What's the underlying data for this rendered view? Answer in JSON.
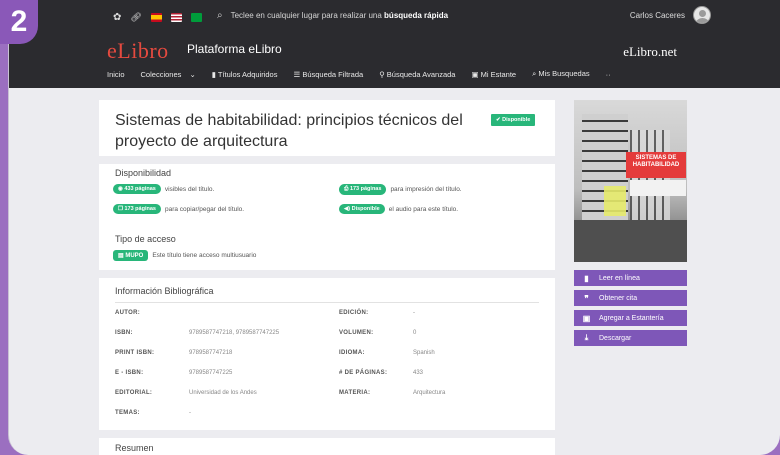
{
  "step_number": "2",
  "header": {
    "search_prefix": "Teclee en cualquier lugar para realizar una",
    "search_bold": "búsqueda rápida",
    "user_name": "Carlos Caceres",
    "logo": "eLibro",
    "platform": "Plataforma eLibro",
    "brand_right": "eLibro.net"
  },
  "nav": {
    "items": [
      "Inicio",
      "Colecciones",
      "Títulos Adquiridos",
      "Búsqueda Filtrada",
      "Búsqueda Avanzada",
      "Mi Estante",
      "Mis Busquedas",
      "··"
    ]
  },
  "book": {
    "title": "Sistemas de habitabilidad: principios técnicos del proyecto de arquitectura",
    "status_badge": "Disponible"
  },
  "availability": {
    "heading": "Disponibilidad",
    "rows": [
      {
        "pill": "433 páginas",
        "text": "visibles del título."
      },
      {
        "pill": "173 páginas",
        "text": "para impresión del título."
      },
      {
        "pill": "173 páginas",
        "text": "para copiar/pegar del título."
      },
      {
        "pill": "Disponible",
        "text": "el audio para este título."
      }
    ]
  },
  "access": {
    "heading": "Tipo de acceso",
    "badge": "MUPO",
    "text": "Este título tiene acceso multiusuario"
  },
  "biblio": {
    "heading": "Información Bibliográfica",
    "left": [
      {
        "label": "AUTOR:",
        "value": ""
      },
      {
        "label": "ISBN:",
        "value": "9789587747218, 9789587747225"
      },
      {
        "label": "PRINT ISBN:",
        "value": "9789587747218"
      },
      {
        "label": "E - ISBN:",
        "value": "9789587747225"
      },
      {
        "label": "EDITORIAL:",
        "value": "Universidad de los Andes"
      },
      {
        "label": "TEMAS:",
        "value": "-"
      }
    ],
    "right": [
      {
        "label": "EDICIÓN:",
        "value": "-"
      },
      {
        "label": "VOLUMEN:",
        "value": "0"
      },
      {
        "label": "IDIOMA:",
        "value": "Spanish"
      },
      {
        "label": "# DE PÁGINAS:",
        "value": "433"
      },
      {
        "label": "MATERIA:",
        "value": "Arquitectura"
      }
    ]
  },
  "summary": {
    "heading": "Resumen"
  },
  "cover": {
    "title": "SISTEMAS DE HABITABILIDAD"
  },
  "actions": [
    "Leer en línea",
    "Obtener cita",
    "Agregar a Estantería",
    "Descargar"
  ],
  "colors": {
    "accent": "#7e57b8",
    "green": "#28b67a",
    "header": "#2b2b2f",
    "logo": "#e54a3f"
  }
}
